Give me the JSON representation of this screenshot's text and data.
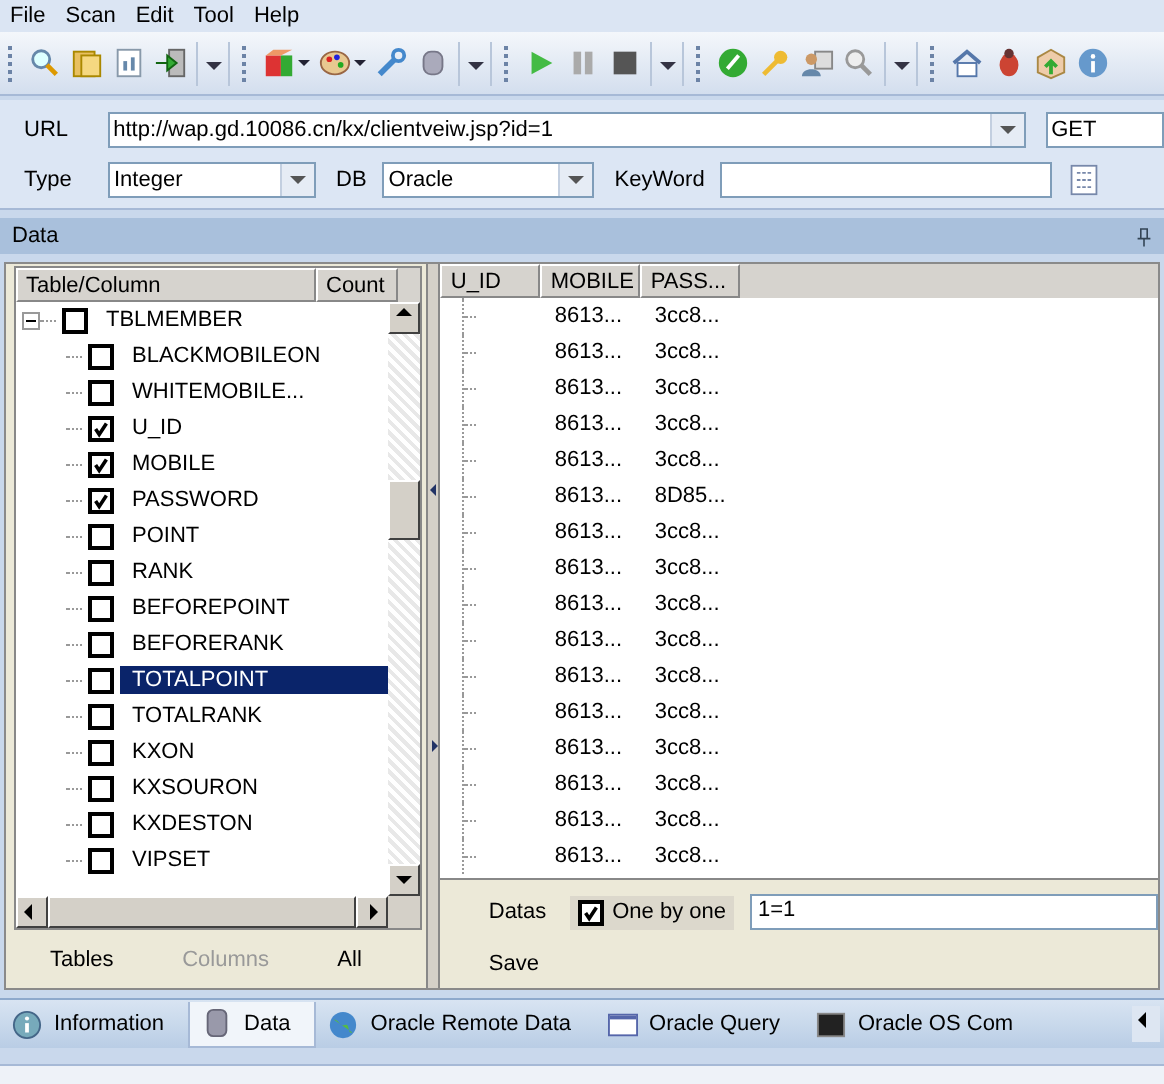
{
  "menu": [
    "File",
    "Scan",
    "Edit",
    "Tool",
    "Help"
  ],
  "request": {
    "url_label": "URL",
    "url": "http://wap.gd.10086.cn/kx/clientveiw.jsp?id=1",
    "method": "GET",
    "type_label": "Type",
    "type": "Integer",
    "db_label": "DB",
    "db": "Oracle",
    "keyword_label": "KeyWord"
  },
  "data_panel": {
    "title": "Data"
  },
  "tree": {
    "columns": [
      "Table/Column",
      "Count"
    ],
    "tables": [
      {
        "name": "TBLMEMBER",
        "checked": false,
        "expanded": true,
        "children": [
          {
            "name": "BLACKMOBILEON",
            "checked": false,
            "selected": false
          },
          {
            "name": "WHITEMOBILE...",
            "checked": false,
            "selected": false
          },
          {
            "name": "U_ID",
            "checked": true,
            "selected": false
          },
          {
            "name": "MOBILE",
            "checked": true,
            "selected": false
          },
          {
            "name": "PASSWORD",
            "checked": true,
            "selected": false
          },
          {
            "name": "POINT",
            "checked": false,
            "selected": false
          },
          {
            "name": "RANK",
            "checked": false,
            "selected": false
          },
          {
            "name": "BEFOREPOINT",
            "checked": false,
            "selected": false
          },
          {
            "name": "BEFORERANK",
            "checked": false,
            "selected": false
          },
          {
            "name": "TOTALPOINT",
            "checked": false,
            "selected": true
          },
          {
            "name": "TOTALRANK",
            "checked": false,
            "selected": false
          },
          {
            "name": "KXON",
            "checked": false,
            "selected": false
          },
          {
            "name": "KXSOURON",
            "checked": false,
            "selected": false
          },
          {
            "name": "KXDESTON",
            "checked": false,
            "selected": false
          },
          {
            "name": "VIPSET",
            "checked": false,
            "selected": false
          }
        ]
      }
    ]
  },
  "tree_buttons": [
    {
      "label": "Tables",
      "disabled": false
    },
    {
      "label": "Columns",
      "disabled": true
    },
    {
      "label": "All",
      "disabled": false
    }
  ],
  "grid": {
    "columns": [
      "U_ID",
      "MOBILE",
      "PASS..."
    ],
    "rows": [
      {
        "mobile": "8613...",
        "password": "3cc8..."
      },
      {
        "mobile": "8613...",
        "password": "3cc8..."
      },
      {
        "mobile": "8613...",
        "password": "3cc8..."
      },
      {
        "mobile": "8613...",
        "password": "3cc8..."
      },
      {
        "mobile": "8613...",
        "password": "3cc8..."
      },
      {
        "mobile": "8613...",
        "password": "8D85..."
      },
      {
        "mobile": "8613...",
        "password": "3cc8..."
      },
      {
        "mobile": "8613...",
        "password": "3cc8..."
      },
      {
        "mobile": "8613...",
        "password": "3cc8..."
      },
      {
        "mobile": "8613...",
        "password": "3cc8..."
      },
      {
        "mobile": "8613...",
        "password": "3cc8..."
      },
      {
        "mobile": "8613...",
        "password": "3cc8..."
      },
      {
        "mobile": "8613...",
        "password": "3cc8..."
      },
      {
        "mobile": "8613...",
        "password": "3cc8..."
      },
      {
        "mobile": "8613...",
        "password": "3cc8..."
      },
      {
        "mobile": "8613...",
        "password": "3cc8..."
      }
    ]
  },
  "options": {
    "datas_label": "Datas",
    "one_by_one": {
      "label": "One by one",
      "checked": true
    },
    "condition": "1=1",
    "save": "Save"
  },
  "bottom_tabs": [
    {
      "label": "Information",
      "selected": false
    },
    {
      "label": "Data",
      "selected": true
    },
    {
      "label": "Oracle Remote Data",
      "selected": false
    },
    {
      "label": "Oracle Query",
      "selected": false
    },
    {
      "label": "Oracle OS Com",
      "selected": false
    }
  ]
}
